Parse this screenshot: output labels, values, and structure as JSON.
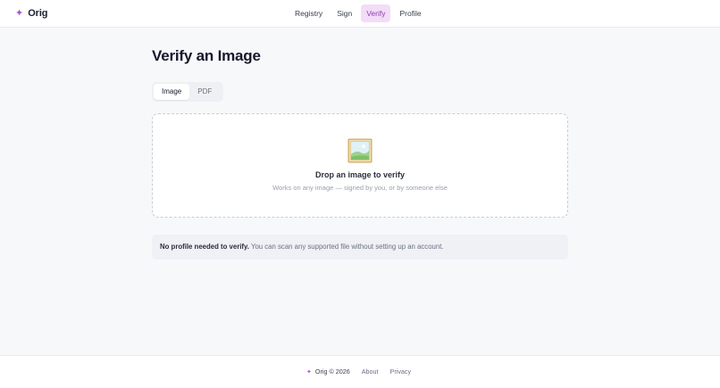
{
  "header": {
    "logo_mark": "✦",
    "logo_text": "Orig",
    "nav": [
      {
        "label": "Registry",
        "active": false
      },
      {
        "label": "Sign",
        "active": false
      },
      {
        "label": "Verify",
        "active": true
      },
      {
        "label": "Profile",
        "active": false
      }
    ]
  },
  "main": {
    "title": "Verify an Image",
    "tabs": [
      {
        "label": "Image",
        "active": true
      },
      {
        "label": "PDF",
        "active": false
      }
    ],
    "dropzone": {
      "icon": "framed-picture-icon",
      "title": "Drop an image to verify",
      "subtitle": "Works on any image — signed by you, or by someone else"
    },
    "notice": {
      "bold": "No profile needed to verify.",
      "text": " You can scan any supported file without setting up an account."
    }
  },
  "footer": {
    "mark": "✦",
    "brand": "Orig © 2026",
    "links": [
      "About",
      "Privacy"
    ]
  },
  "colors": {
    "accent": "#b04fd6",
    "nav_active_bg": "#f3dcf7",
    "nav_active_text": "#8e3fb0",
    "page_bg": "#f7f8fa"
  }
}
